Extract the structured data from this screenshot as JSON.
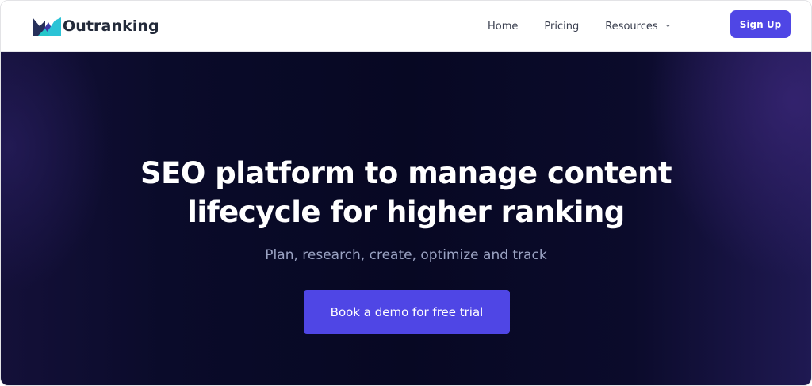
{
  "brand": {
    "name": "Outranking",
    "logo_icon": "outranking-logo-icon",
    "accent": "#4f46e5"
  },
  "nav": {
    "items": [
      {
        "label": "Home"
      },
      {
        "label": "Pricing"
      },
      {
        "label": "Resources",
        "icon": "chevron-down-icon"
      }
    ],
    "signup_label": "Sign Up"
  },
  "hero": {
    "title_line1": "SEO platform to manage content",
    "title_line2": "lifecycle for higher ranking",
    "subtitle": "Plan, research, create, optimize and track",
    "cta_label": "Book a demo for free trial"
  }
}
